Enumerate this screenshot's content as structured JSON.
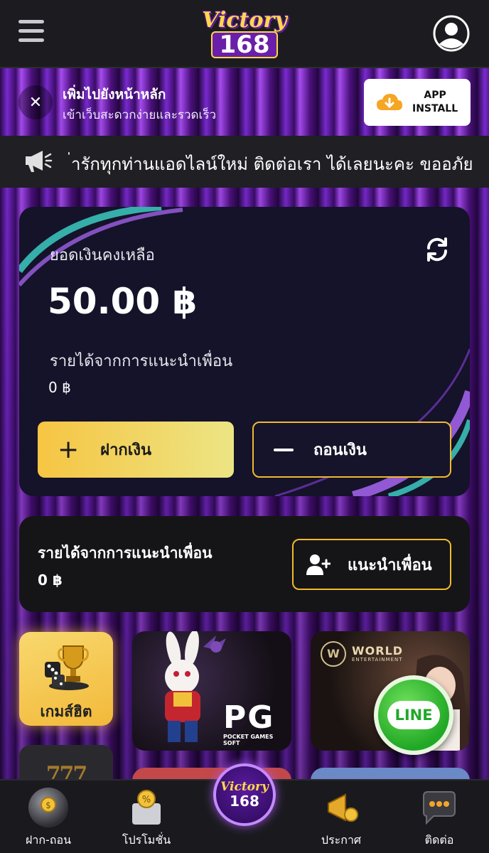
{
  "header": {
    "logo_top": "Victory",
    "logo_bottom": "168"
  },
  "install_banner": {
    "title": "เพิ่มไปยังหน้าหลัก",
    "subtitle": "เข้าเว็บสะดวกง่ายและรวดเร็ว",
    "button_line1": "APP",
    "button_line2": "INSTALL"
  },
  "announcement": {
    "text": "่ารักทุกท่านแอดไลน์ใหม่ ติดต่อเรา ได้เลยนะคะ ขออภัย"
  },
  "balance": {
    "label": "ยอดเงินคงเหลือ",
    "amount": "50.00 ฿",
    "referral_label": "รายได้จากการแนะนำเพื่อน",
    "referral_amount": "0 ฿",
    "deposit_label": "ฝากเงิน",
    "withdraw_label": "ถอนเงิน"
  },
  "referral_card": {
    "title": "รายได้จากการแนะนำเพื่อน",
    "amount": "0 ฿",
    "invite_label": "แนะนำเพื่อน"
  },
  "categories": {
    "hot_label": "เกมส์ฮิต",
    "slot_partial": "777"
  },
  "tiles": {
    "pg_logo": "PG",
    "pg_sub": "POCKET GAMES SOFT",
    "world_logo": "WORLD",
    "world_sub": "ENTERTAINMENT",
    "world_mark": "W"
  },
  "line_button": {
    "label": "LINE"
  },
  "bottom_nav": {
    "items": [
      {
        "label": "ฝาก-ถอน"
      },
      {
        "label": "โปรโมชั่น"
      },
      {
        "label": "ประกาศ"
      },
      {
        "label": "ติดต่อ"
      }
    ],
    "center_top": "Victory",
    "center_bottom": "168"
  },
  "colors": {
    "accent_gold": "#f2b92e",
    "card_bg": "#141329",
    "line_green": "#21a826"
  }
}
